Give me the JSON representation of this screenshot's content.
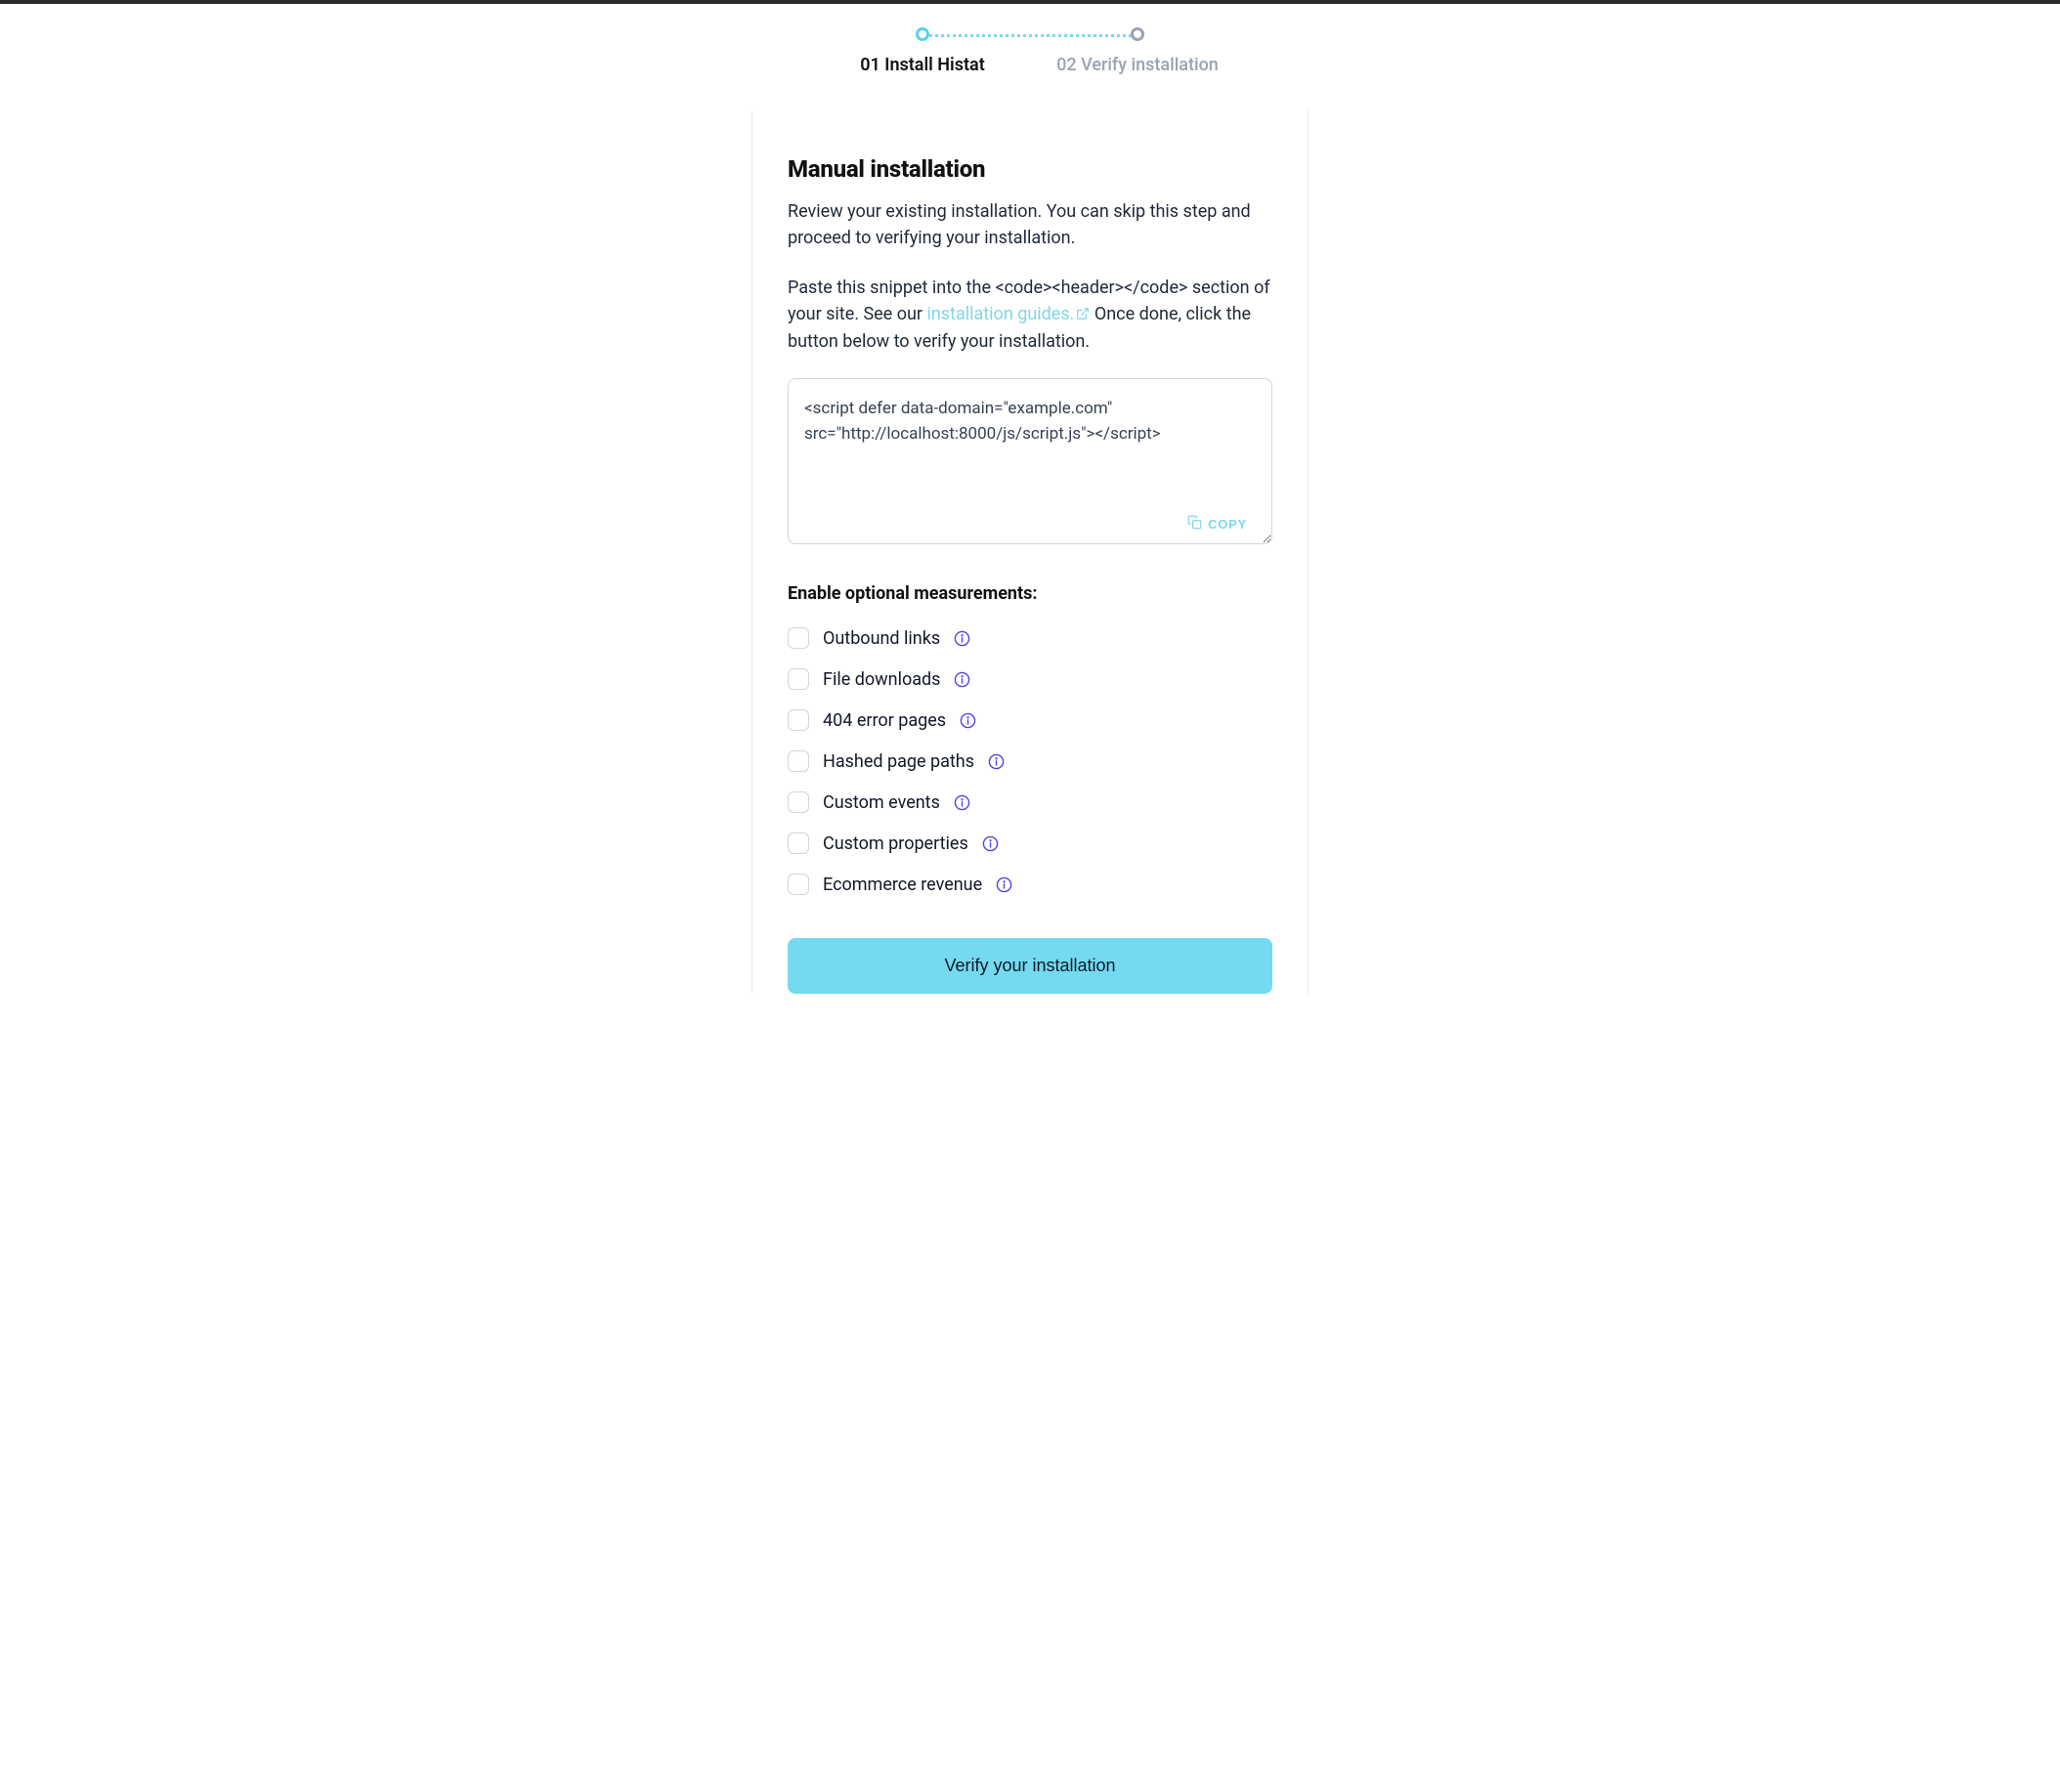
{
  "stepper": {
    "steps": [
      {
        "label": "01 Install Histat",
        "active": true
      },
      {
        "label": "02 Verify installation",
        "active": false
      }
    ]
  },
  "page": {
    "title": "Manual installation",
    "lead": "Review your existing installation. You can skip this step and proceed to verifying your installation.",
    "instr_prefix": "Paste this snippet into the ",
    "instr_code": "<code><header></code>",
    "instr_mid": " section of your site. See our ",
    "guides_link_text": "installation guides.",
    "instr_suffix": " Once done, click the button below to verify your installation."
  },
  "snippet": {
    "value": "<script defer data-domain=\"example.com\" src=\"http://localhost:8000/js/script.js\"></script>",
    "copy_label": "COPY"
  },
  "optional": {
    "heading": "Enable optional measurements:",
    "items": [
      {
        "label": "Outbound links"
      },
      {
        "label": "File downloads"
      },
      {
        "label": "404 error pages"
      },
      {
        "label": "Hashed page paths"
      },
      {
        "label": "Custom events"
      },
      {
        "label": "Custom properties"
      },
      {
        "label": "Ecommerce revenue"
      }
    ]
  },
  "cta": {
    "verify_label": "Verify your installation"
  }
}
